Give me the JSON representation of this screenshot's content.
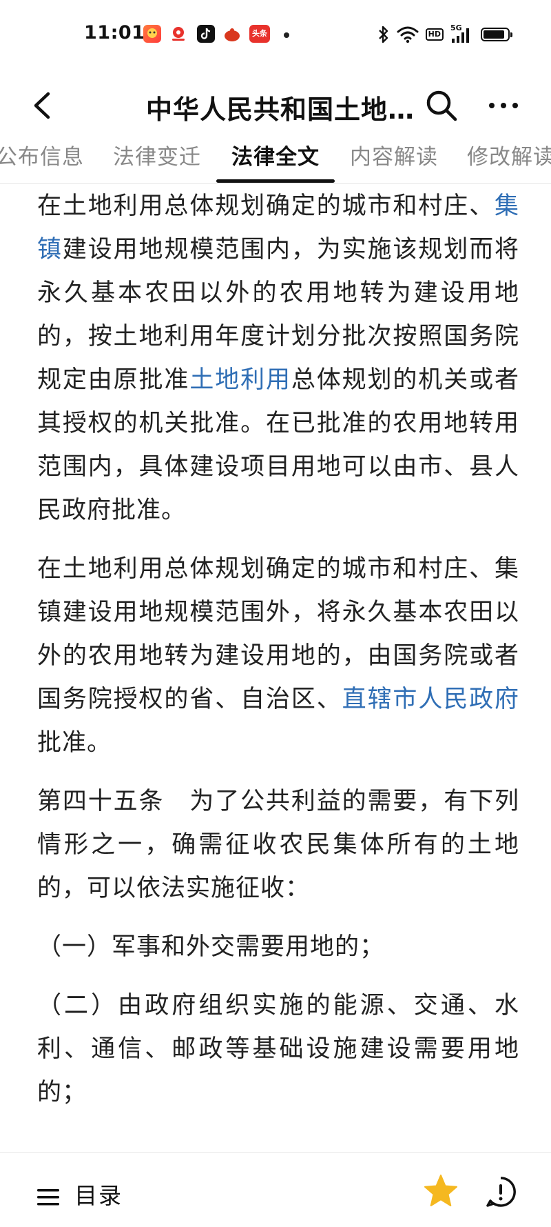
{
  "status_bar": {
    "time": "11:01",
    "notification_icons": [
      "app-icon-1",
      "app-icon-2",
      "tiktok-icon",
      "app-icon-4",
      "toutiao-icon"
    ],
    "toutiao_label": "头条",
    "hd_label": "HD",
    "network_label": "5G",
    "battery_level": 0.9
  },
  "header": {
    "title": "中华人民共和国土地…",
    "back_icon": "chevron-left-icon",
    "search_icon": "search-icon",
    "more_icon": "more-horizontal-icon"
  },
  "tabs": [
    {
      "label": "公布信息",
      "active": false
    },
    {
      "label": "法律变迁",
      "active": false
    },
    {
      "label": "法律全文",
      "active": true
    },
    {
      "label": "内容解读",
      "active": false
    },
    {
      "label": "修改解读",
      "active": false
    }
  ],
  "content": {
    "p1": {
      "a": "在土地利用总体规划确定的城市和村庄、",
      "link1": "集镇",
      "b": "建设用地规模范围内，为实施该规划而将永久基本农田以外的农用地转为建设用地的，按土地利用年度计划分批次按照国务院规定由原批准",
      "link2": "土地利用",
      "c": "总体规划的机关或者其授权的机关批准。在已批准的农用地转用范围内，具体建设项目用地可以由市、县人民政府批准。"
    },
    "p2": {
      "a": "在土地利用总体规划确定的城市和村庄、集镇建设用地规模范围外，将永久基本农田以外的农用地转为建设用地的，由国务院或者国务院授权的省、自治区、",
      "link": "直辖市人民政府",
      "b": "批准。"
    },
    "p3": "第四十五条　为了公共利益的需要，有下列情形之一，确需征收农民集体所有的土地的，可以依法实施征收：",
    "p4": "（一）军事和外交需要用地的；",
    "p5": "（二）由政府组织实施的能源、交通、水利、通信、邮政等基础设施建设需要用地的；"
  },
  "colors": {
    "link": "#2f6eb5",
    "star": "#f5b820",
    "text": "#222222"
  },
  "bottom_bar": {
    "catalog_label": "目录",
    "menu_icon": "menu-icon",
    "star_icon": "star-icon",
    "feedback_icon": "feedback-icon"
  }
}
